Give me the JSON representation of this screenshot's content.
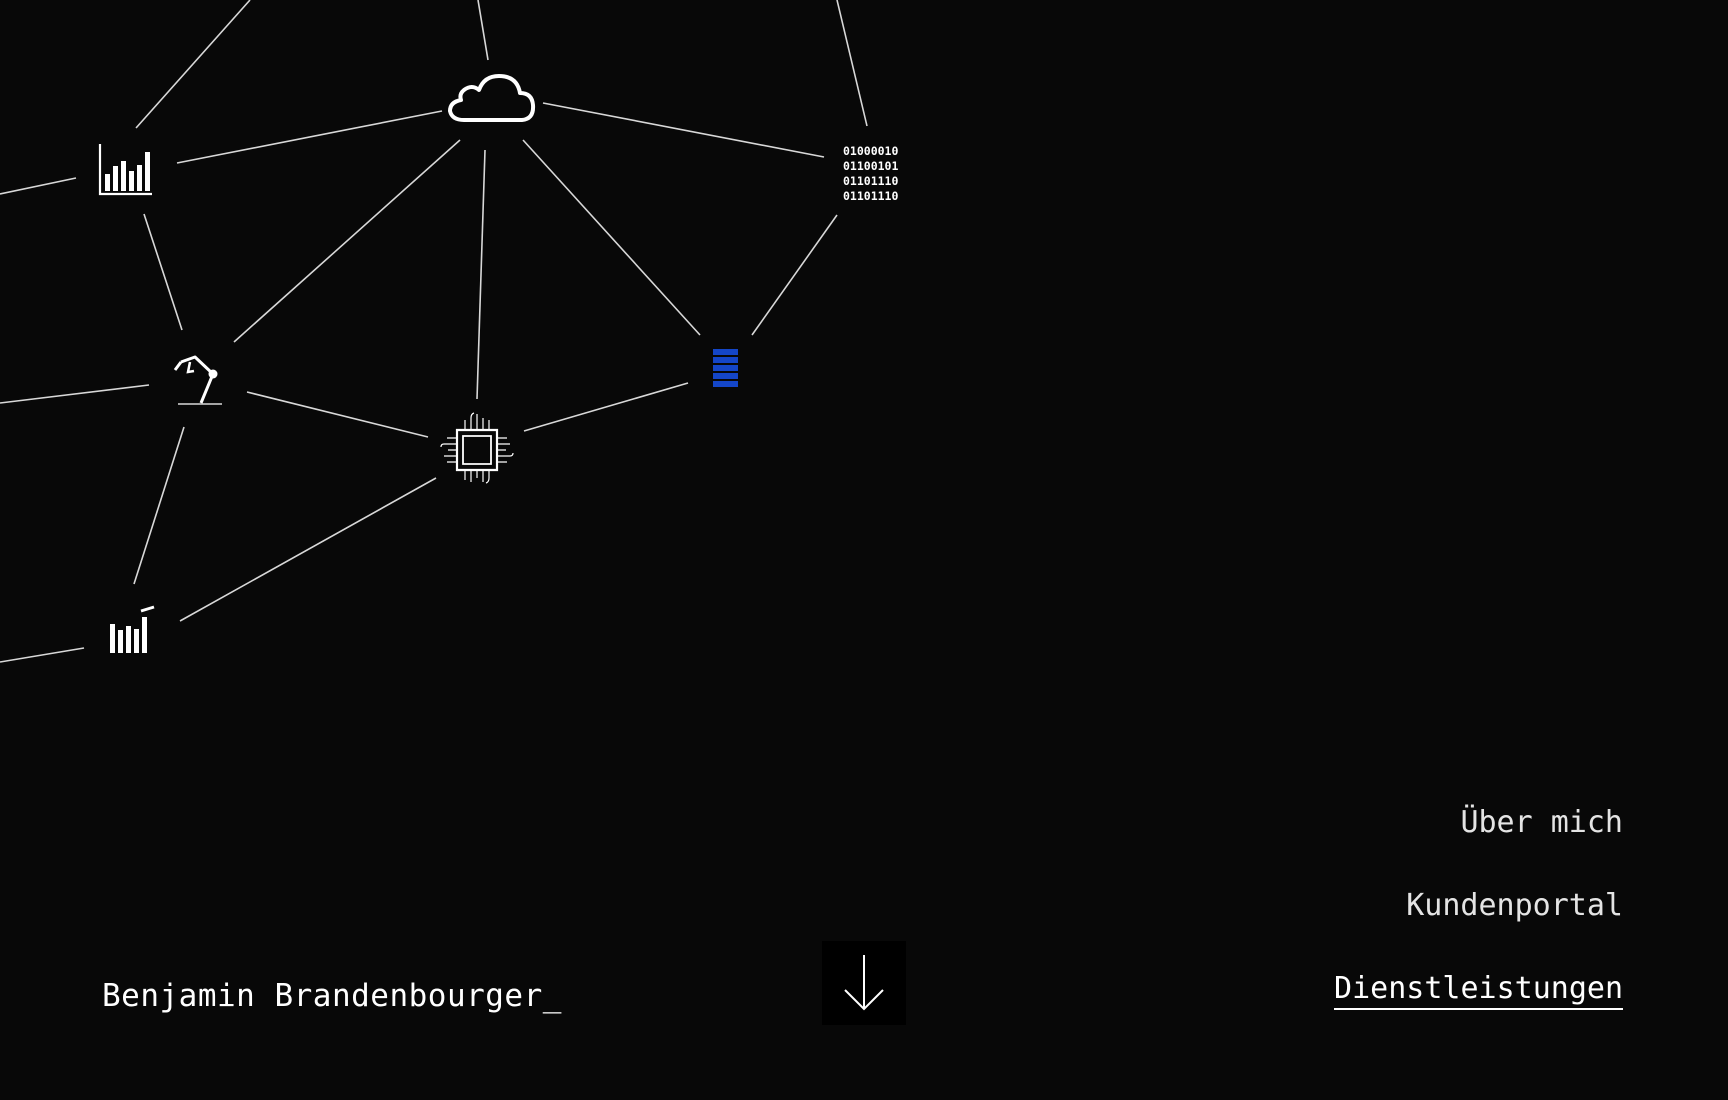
{
  "brand": {
    "name": "Benjamin Brandenbourger_"
  },
  "nav": {
    "items": [
      {
        "label": "Über mich",
        "active": false
      },
      {
        "label": "Kundenportal",
        "active": false
      },
      {
        "label": "Dienstleistungen",
        "active": true
      }
    ]
  },
  "scroll_button": {
    "icon": "arrow-down-icon"
  },
  "network": {
    "icons": [
      "cloud-icon",
      "bar-chart-icon",
      "binary-code-icon",
      "robot-arm-icon",
      "cpu-chip-icon",
      "server-rack-icon",
      "rising-bars-icon"
    ],
    "binary_lines": [
      "01000010",
      "01100101",
      "01101110",
      "01101110"
    ],
    "accent_color": "#1446c8",
    "line_color": "#d8d8d8"
  }
}
